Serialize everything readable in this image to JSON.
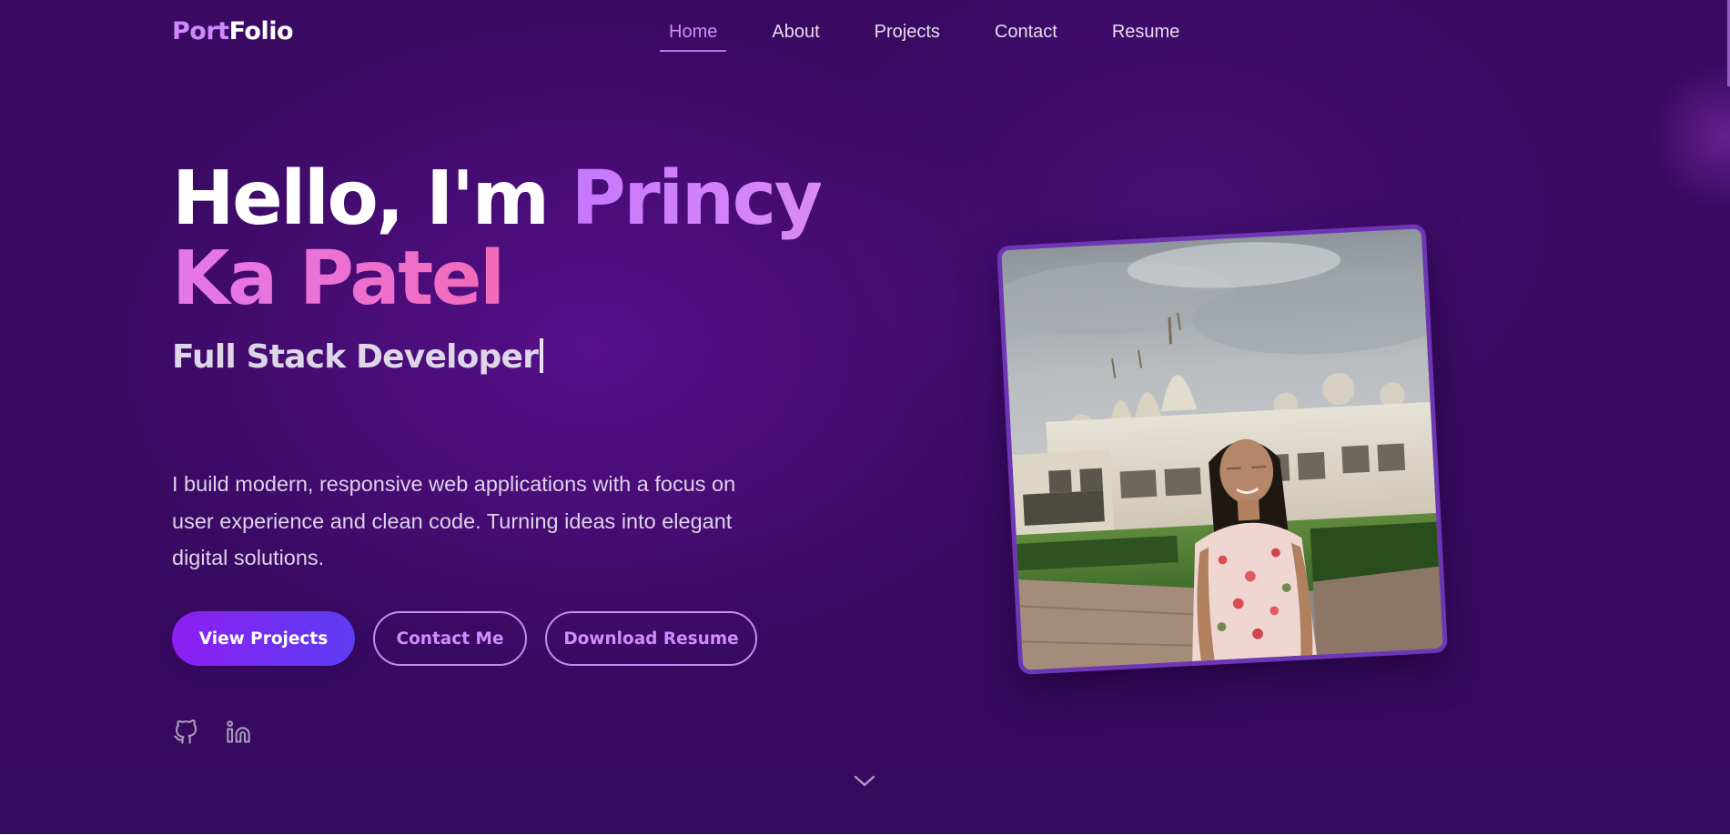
{
  "brand": {
    "part1": "Port",
    "part2": "Folio"
  },
  "nav": {
    "items": [
      {
        "label": "Home",
        "active": true
      },
      {
        "label": "About",
        "active": false
      },
      {
        "label": "Projects",
        "active": false
      },
      {
        "label": "Contact",
        "active": false
      },
      {
        "label": "Resume",
        "active": false
      }
    ]
  },
  "hero": {
    "greeting": "Hello, I'm",
    "first_name": "Princy",
    "last_name": "Ka Patel",
    "role": "Full Stack Developer",
    "description": "I build modern, responsive web applications with a focus on user experience and clean code. Turning ideas into elegant digital solutions."
  },
  "buttons": {
    "primary": "View Projects",
    "contact": "Contact Me",
    "resume": "Download Resume"
  },
  "social": [
    {
      "name": "github-icon"
    },
    {
      "name": "linkedin-icon"
    }
  ],
  "icons": {
    "scroll": "chevron-down-icon"
  },
  "colors": {
    "background": "#3a0a62",
    "accent": "#cf8cff",
    "button_gradient_start": "#8d1ff2",
    "button_gradient_end": "#5b3df2",
    "name_pink": "#f36bb8"
  }
}
